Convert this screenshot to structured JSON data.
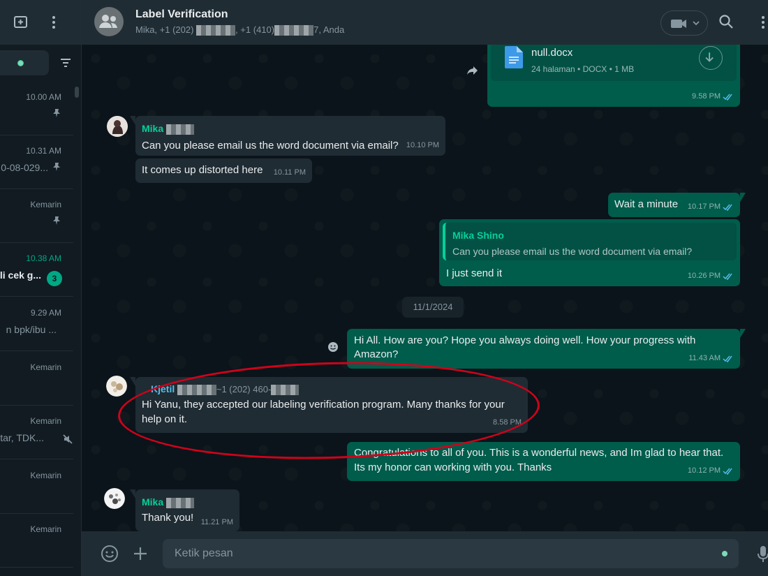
{
  "sidebar": {
    "chats": [
      {
        "time": "10.00 AM",
        "preview": "",
        "pinned": true
      },
      {
        "time": "10.31 AM",
        "preview": "0-08-029...",
        "pinned": true
      },
      {
        "time": "Kemarin",
        "preview": "",
        "pinned": true
      },
      {
        "time": "10.38 AM",
        "preview": "li cek g...",
        "unread": "3"
      },
      {
        "time": "9.29 AM",
        "preview": "n bpk/ibu ..."
      },
      {
        "time": "Kemarin",
        "preview": ""
      },
      {
        "time": "Kemarin",
        "preview": "tar, TDK...",
        "muted": true
      },
      {
        "time": "Kemarin",
        "preview": ""
      },
      {
        "time": "Kemarin",
        "preview": ""
      }
    ]
  },
  "header": {
    "title": "Label Verification",
    "subtitle_part1": "Mika, +1 (202) ",
    "subtitle_part2": ", +1 (410)",
    "subtitle_part3": "7, Anda"
  },
  "messages": {
    "doc": {
      "name": "null.docx",
      "info": "24 halaman • DOCX • 1 MB",
      "time": "9.58 PM"
    },
    "m1": {
      "sender": "Mika",
      "text": "Can you please email us the word document via email?",
      "time": "10.10 PM"
    },
    "m2": {
      "text": "It comes up distorted here",
      "time": "10.11 PM"
    },
    "m3": {
      "text": "Wait a minute",
      "time": "10.17 PM"
    },
    "m4": {
      "quote_name": "Mika Shino",
      "quote_text": "Can you please email us the word document via email?",
      "text": "I just send it",
      "time": "10.26 PM"
    },
    "date_divider": "11/1/2024",
    "m5": {
      "text_line1": "Hi All. How are you? Hope you always doing well. How your progress with",
      "text_line2": "Amazon?",
      "time": "11.43 AM"
    },
    "m6": {
      "sender": "Kjetil",
      "phone_a": "~1 (202) 460-",
      "text_line1": "Hi Yanu, they accepted our labeling verification program.  Many thanks for your",
      "text_line2": "help on it.",
      "time": "8.58 PM"
    },
    "m7": {
      "text_line1": "Congratulations to all of you. This is a wonderful news, and Im glad to hear that.",
      "text_line2": "Its my honor can working with you. Thanks",
      "time": "10.12 PM"
    },
    "m8": {
      "sender": "Mika",
      "text": "Thank you!",
      "time": "11.21 PM"
    }
  },
  "composer": {
    "placeholder": "Ketik pesan"
  },
  "colors": {
    "accent": "#00a884",
    "outgoing": "#005c4b",
    "incoming": "#202c33",
    "highlight": "#d0021b"
  }
}
